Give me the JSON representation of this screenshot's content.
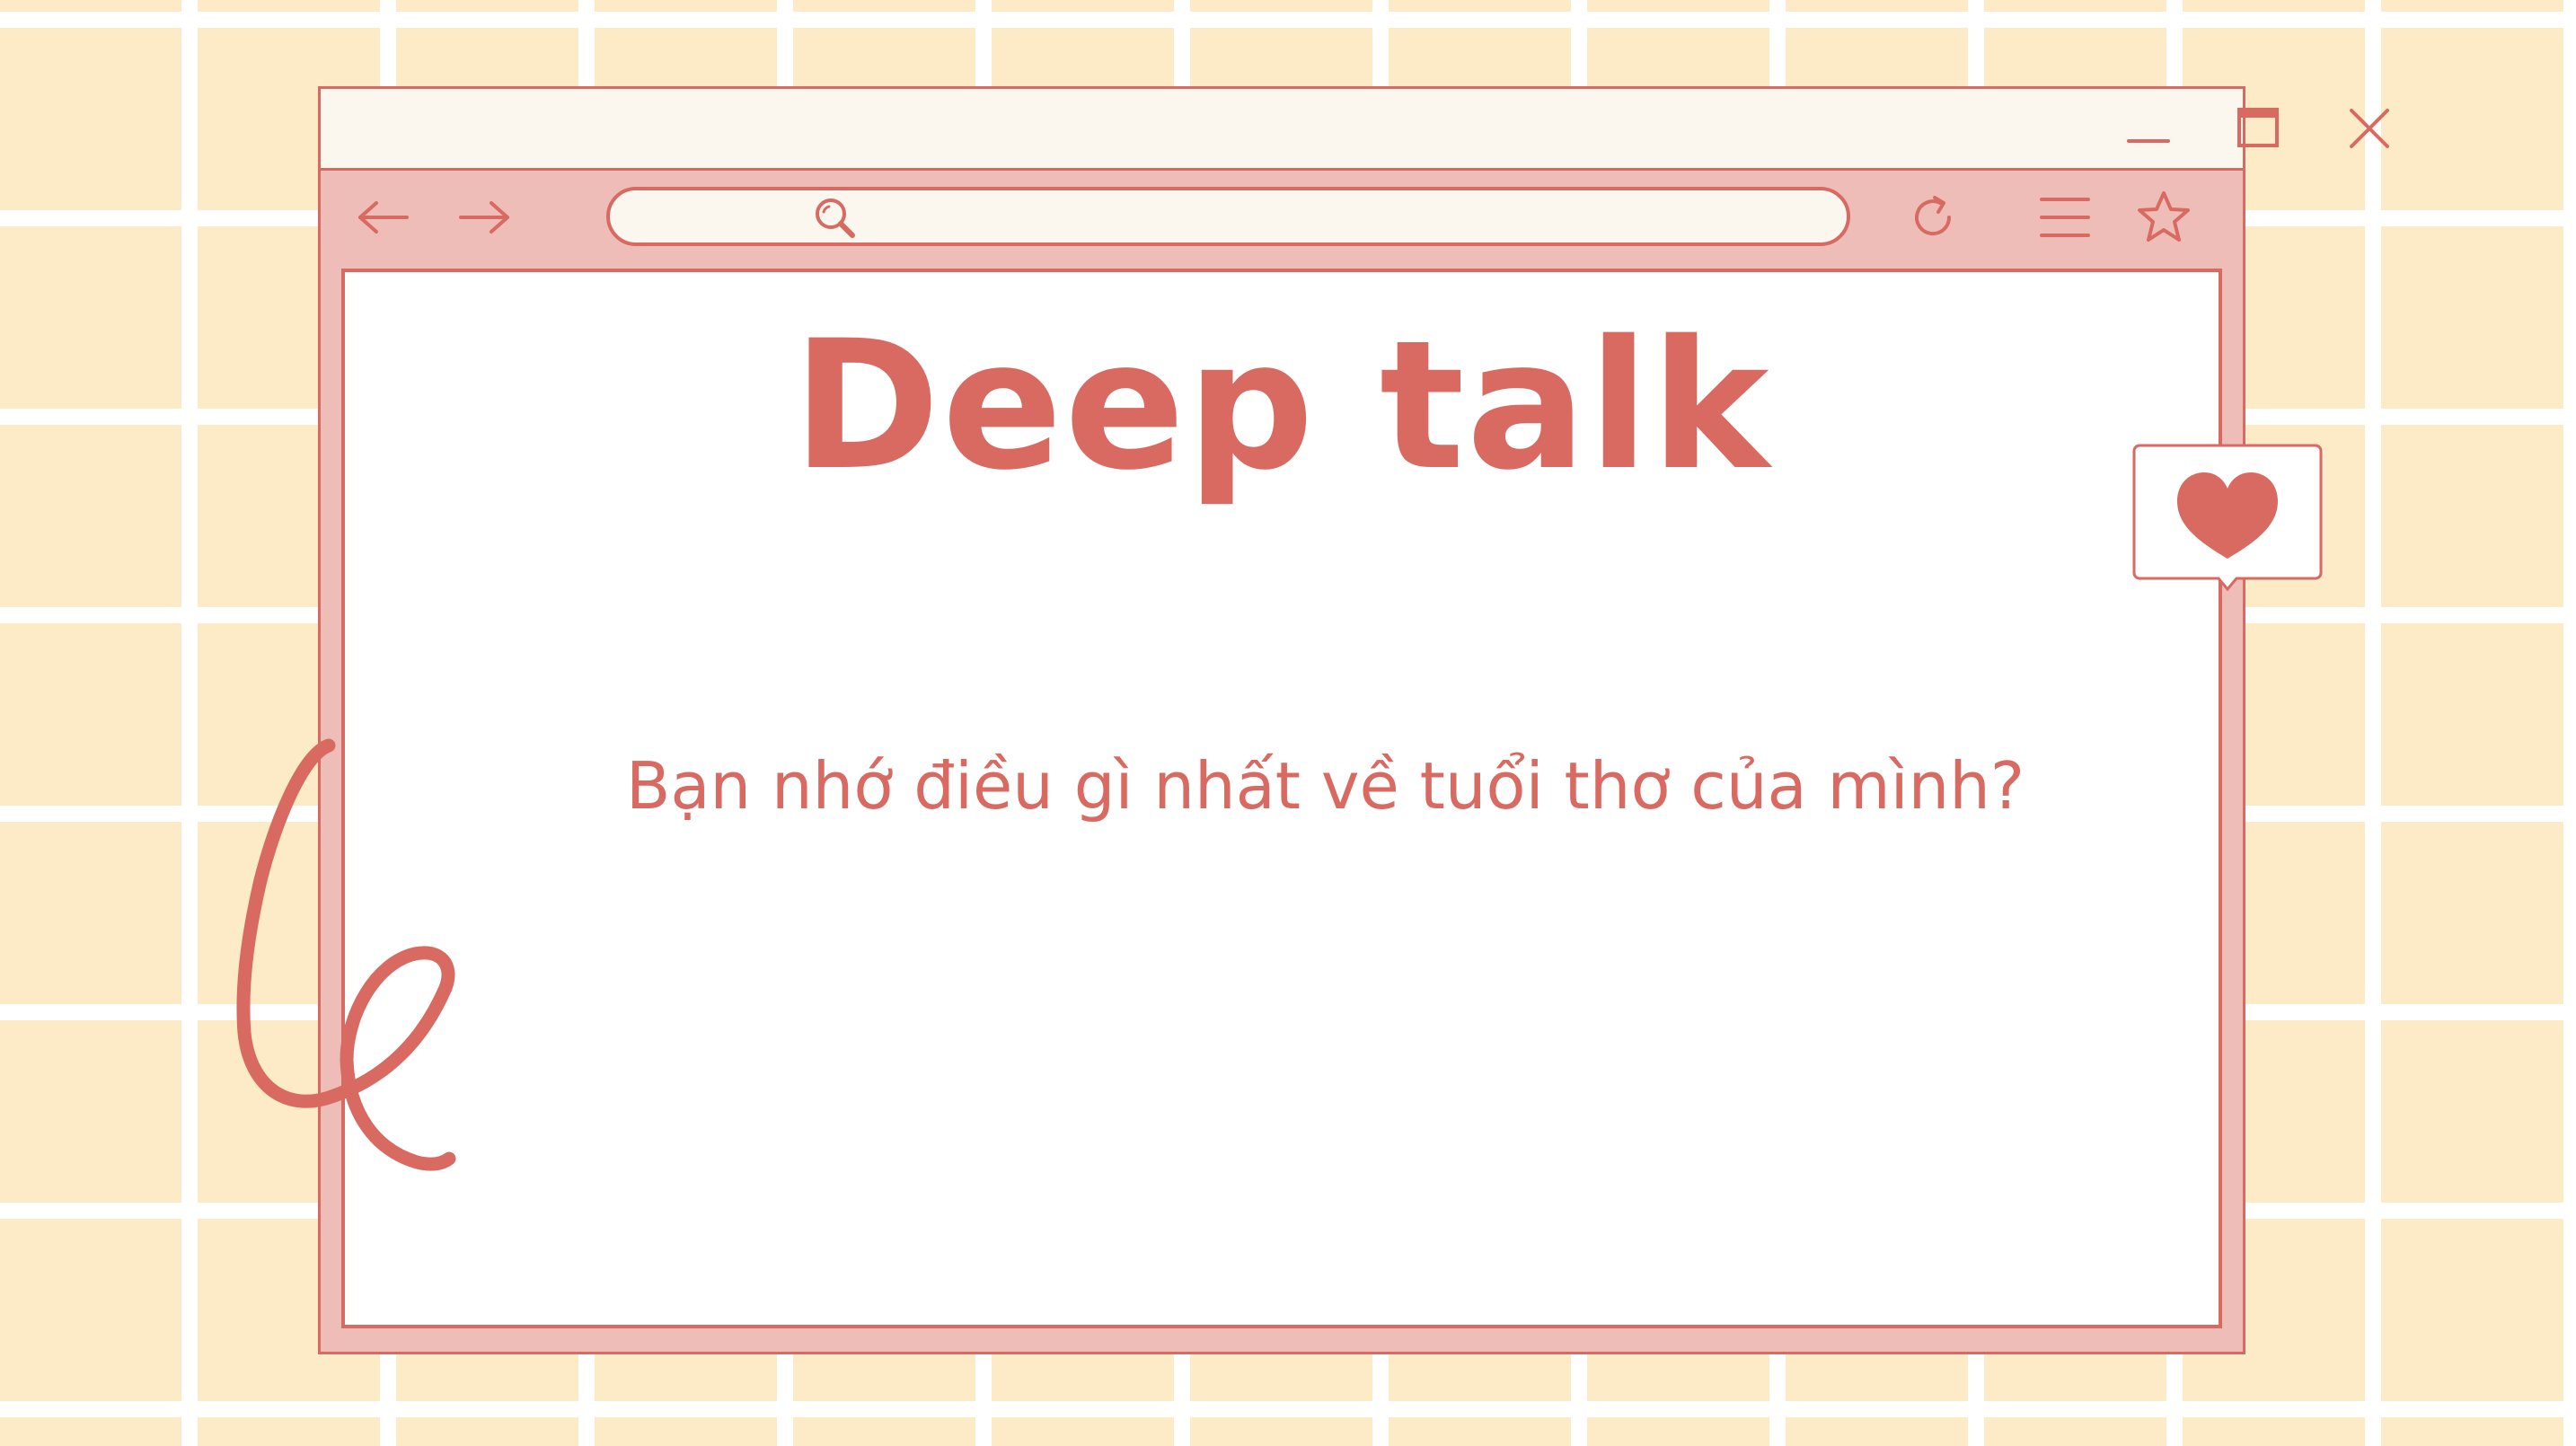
{
  "slide": {
    "title": "Deep talk",
    "question": "Bạn nhớ điều gì nhất về tuổi thơ của mình?"
  },
  "browser": {
    "address_value": "",
    "icons": {
      "minimize": "minimize-icon",
      "maximize": "maximize-icon",
      "close": "close-icon",
      "back": "arrow-left-icon",
      "forward": "arrow-right-icon",
      "search": "search-icon",
      "reload": "reload-icon",
      "menu": "hamburger-menu-icon",
      "favorite": "star-icon",
      "like": "heart-icon"
    }
  },
  "colors": {
    "accent": "#d86a62",
    "chrome_pink": "#efbdb8",
    "titlebar": "#fcf7ee",
    "grid_background": "#fdebc8",
    "grid_lines": "#ffffff",
    "content_background": "#ffffff"
  }
}
